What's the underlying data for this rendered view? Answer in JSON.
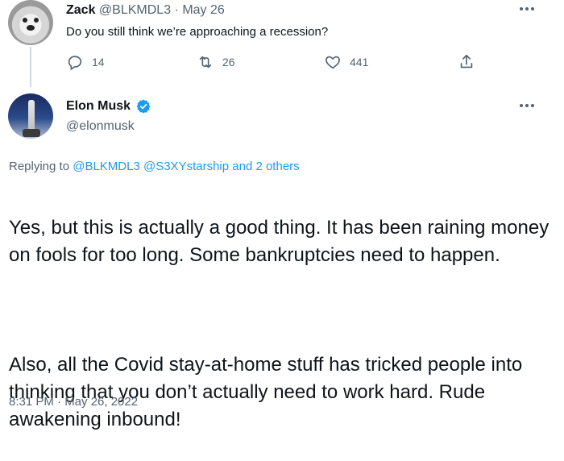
{
  "reply_to": {
    "display_name": "Zack",
    "handle": "@BLKMDL3",
    "separator": " · ",
    "date": "May 26",
    "text": "Do you still think we’re approaching a recession?",
    "actions": {
      "replies": "14",
      "retweets": "26",
      "likes": "441"
    }
  },
  "tweet": {
    "display_name": "Elon Musk",
    "handle": "@elonmusk",
    "replying_prefix": "Replying to",
    "replying_handles": [
      "@BLKMDL3",
      "@S3XYstarship"
    ],
    "replying_suffix": "and 2 others",
    "paragraph1": "Yes, but this is actually a good thing. It has been raining money on fools for too long. Some bankruptcies need to happen.",
    "paragraph2": "Also, all the Covid stay-at-home stuff has tricked people into thinking that you don’t actually need to work hard. Rude awakening inbound!",
    "timestamp": "8:31 PM · May 26, 2022"
  },
  "icons": {
    "reply": "reply-icon",
    "retweet": "retweet-icon",
    "like": "heart-icon",
    "share": "share-icon",
    "more": "more-icon",
    "verified": "verified-badge-icon"
  },
  "colors": {
    "link": "#1d9bf0",
    "muted": "#536471",
    "text": "#0f1419"
  }
}
